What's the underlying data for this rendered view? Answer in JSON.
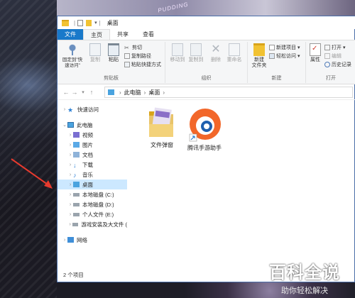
{
  "background": {
    "text": "PUDDING"
  },
  "window": {
    "title": "桌面"
  },
  "tabs": [
    {
      "label": "文件"
    },
    {
      "label": "主页"
    },
    {
      "label": "共享"
    },
    {
      "label": "查看"
    }
  ],
  "ribbon": {
    "clipboard": {
      "label": "剪贴板",
      "pin": "固定到\"快速访问\"",
      "copy": "复制",
      "paste": "粘贴",
      "cut": "剪切",
      "copy_path": "复制路径",
      "paste_shortcut": "粘贴快捷方式"
    },
    "organize": {
      "label": "组织",
      "move_to": "移动到",
      "copy_to": "复制到",
      "delete": "删除",
      "rename": "重命名"
    },
    "new": {
      "label": "新建",
      "new_folder": "新建\n文件夹",
      "new_item": "新建项目 ▾",
      "easy_access": "轻松访问 ▾"
    },
    "open": {
      "label": "打开",
      "properties": "属性",
      "open": "打开 ▾",
      "edit": "编辑",
      "history": "历史记录"
    }
  },
  "address": {
    "crumbs": [
      "此电脑",
      "桌面"
    ]
  },
  "nav": {
    "quick_access": "快速访问",
    "this_pc": "此电脑",
    "items": [
      "视频",
      "图片",
      "文档",
      "下载",
      "音乐",
      "桌面",
      "本地磁盘 (C:)",
      "本地磁盘 (D:)",
      "个人文件 (E:)",
      "游戏安装及大文件 ("
    ],
    "network": "网络"
  },
  "files": [
    {
      "name": "文件弹窗"
    },
    {
      "name": "腾讯手游助手"
    }
  ],
  "status": {
    "count": "2 个项目"
  },
  "watermark": {
    "main": "百科全说",
    "sub": "助你轻松解决"
  },
  "colors": {
    "accent": "#1979ca",
    "selected": "#cce8ff",
    "arrow": "#e63a2e"
  }
}
